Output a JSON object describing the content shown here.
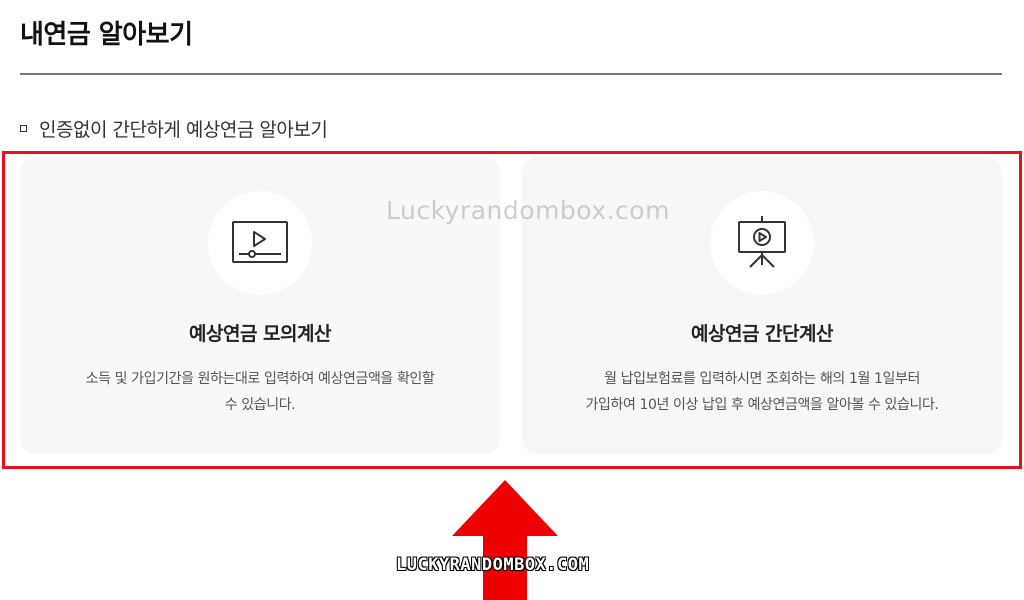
{
  "page": {
    "title": "내연금 알아보기",
    "section_heading": "인증없이 간단하게 예상연금 알아보기"
  },
  "cards": [
    {
      "title": "예상연금 모의계산",
      "desc_line1": "소득 및 가입기간을 원하는대로 입력하여 예상연금액을 확인할",
      "desc_line2": "수 있습니다.",
      "icon": "video-player-icon"
    },
    {
      "title": "예상연금 간단계산",
      "desc_line1": "월 납입보험료를 입력하시면 조회하는 해의 1월 1일부터",
      "desc_line2": "가입하여 10년 이상 납입 후 예상연금액을 알아볼 수 있습니다.",
      "icon": "presentation-board-icon"
    }
  ],
  "overlay": {
    "watermark_top": "Luckyrandombox.com",
    "watermark_bottom": "LUCKYRANDOMBOX.COM",
    "highlight_color": "#e8101a",
    "arrow_color": "#ee0000"
  }
}
